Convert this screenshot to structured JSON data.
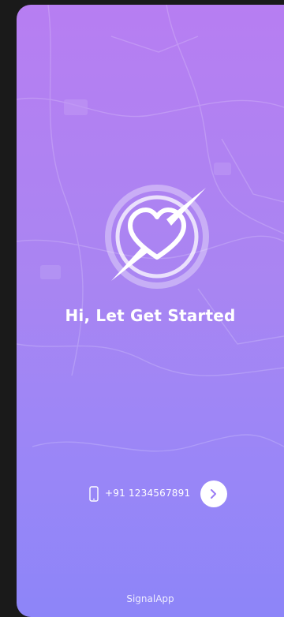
{
  "onboarding": {
    "headline": "Hi, Let Get Started",
    "phone_number": "+91 1234567891",
    "footer_brand": "SignalApp"
  },
  "icons": {
    "logo": "compass-heart-logo",
    "phone": "smartphone-icon",
    "next": "chevron-right-icon"
  },
  "colors": {
    "gradient_top": "#b77ef2",
    "gradient_bottom": "#8d85f8",
    "button_bg": "#ffffff",
    "chevron": "#9b7cf4"
  }
}
